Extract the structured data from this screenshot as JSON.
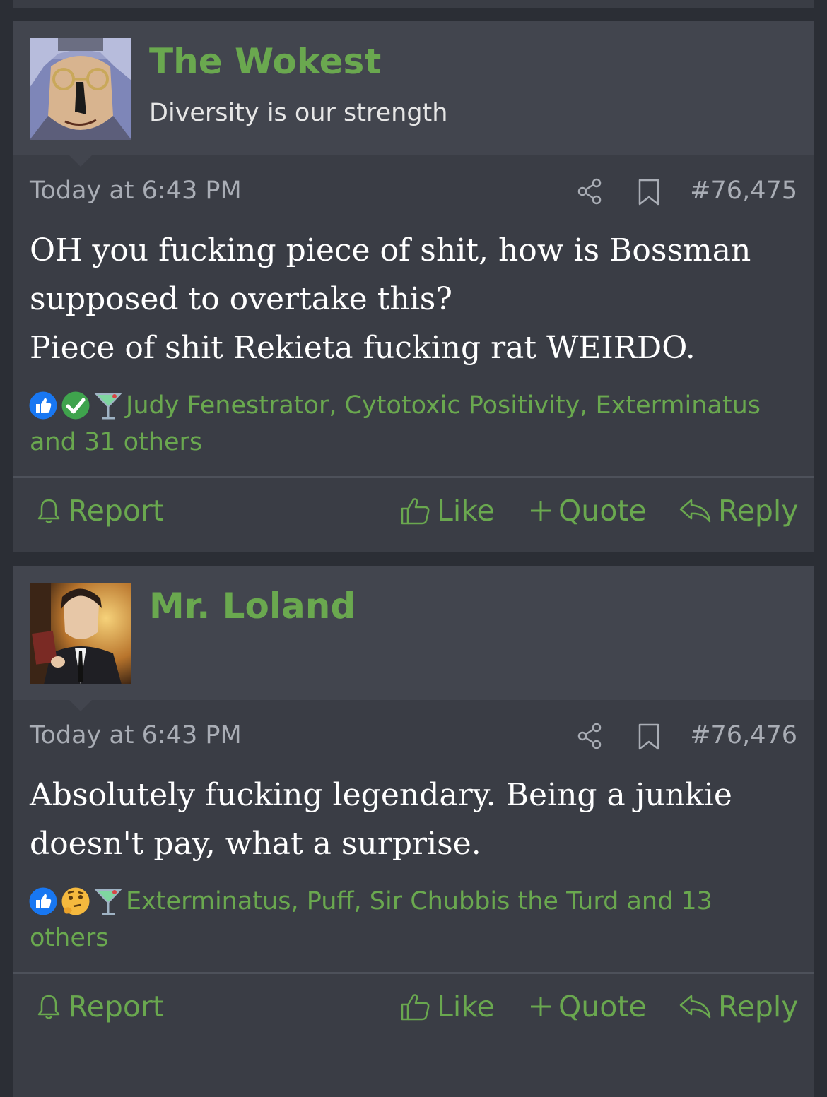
{
  "posts": [
    {
      "username": "The Wokest",
      "user_title": "Diversity is our strength",
      "date": "Today at 6:43 PM",
      "post_number": "#76,475",
      "body_lines": [
        "OH you fucking piece of shit, how is Bossman",
        "supposed to overtake this?",
        "Piece of shit Rekieta fucking rat WEIRDO."
      ],
      "reaction_icons": [
        "like-reaction-icon",
        "agree-checkmark-reaction-icon",
        "cocktail-reaction-icon"
      ],
      "reactions_line1": "Judy Fenestrator, Cytotoxic Positivity, Exterminatus",
      "reactions_line2": "and 31 others",
      "actions": {
        "report": "Report",
        "like": "Like",
        "quote": "Quote",
        "reply": "Reply"
      }
    },
    {
      "username": "Mr. Loland",
      "user_title": "",
      "date": "Today at 6:43 PM",
      "post_number": "#76,476",
      "body_lines": [
        "Absolutely fucking legendary. Being a junkie",
        "doesn't pay, what a surprise."
      ],
      "reaction_icons": [
        "like-reaction-icon",
        "thinking-face-reaction-icon",
        "cocktail-reaction-icon"
      ],
      "reactions_line1": "Exterminatus, Puff, Sir Chubbis the Turd and 13",
      "reactions_line2": "others",
      "actions": {
        "report": "Report",
        "like": "Like",
        "quote": "Quote",
        "reply": "Reply"
      }
    }
  ],
  "colors": {
    "accent": "#6aa84f",
    "page_bg": "#2b2e35",
    "post_bg": "#3a3d45",
    "header_bg": "#42454e",
    "meta_text": "#a9adb5"
  }
}
